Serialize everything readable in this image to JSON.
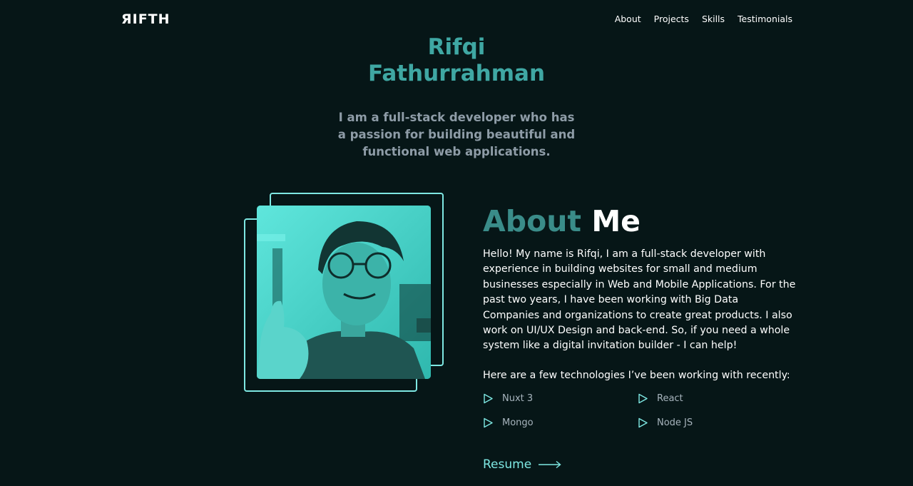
{
  "brand": {
    "logo": "ЯIFTH"
  },
  "nav": {
    "items": [
      {
        "label": "About"
      },
      {
        "label": "Projects"
      },
      {
        "label": "Skills"
      },
      {
        "label": "Testimonials"
      }
    ]
  },
  "hero": {
    "name_line1": "Rifqi",
    "name_line2": "Fathurrahman",
    "tagline": "I am a full-stack developer who has a passion for building beautiful and functional web applications."
  },
  "about": {
    "title_accent": "About",
    "title_rest": "Me",
    "bio": "Hello! My name is Rifqi, I am a full-stack developer with experience in building websites for small and medium businesses especially in Web and Mobile Applications. For the past two years, I have been working with Big Data Companies and organizations to create great products. I also work on UI/UX Design and back-end. So, if you need a whole system like a digital invitation builder - I can help!",
    "tech_intro": "Here are a few technologies I’ve been working with recently:",
    "technologies": [
      {
        "label": "Nuxt 3",
        "icon": "play-outline-icon"
      },
      {
        "label": "React",
        "icon": "play-outline-icon"
      },
      {
        "label": "Mongo",
        "icon": "play-outline-icon"
      },
      {
        "label": "Node JS",
        "icon": "play-outline-icon"
      }
    ],
    "resume_label": "Resume",
    "resume_icon": "long-arrow-right-icon"
  },
  "photo": {
    "alt": "portrait photo"
  },
  "colors": {
    "background": "#061617",
    "accent": "#7ee8e3",
    "heading_teal": "#3fa7a3",
    "muted": "#8e9ca7"
  }
}
